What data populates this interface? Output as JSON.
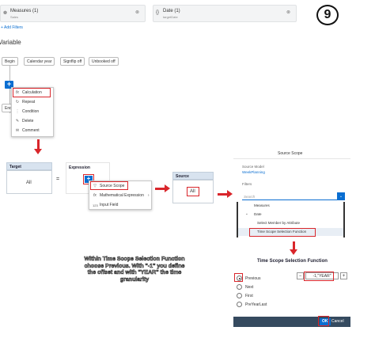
{
  "filters": {
    "measures_title": "Measures (1)",
    "measures_sub": "Sales",
    "date_title": "Date (1)",
    "date_sub": "targetDate",
    "add_filters": "+ Add Filters"
  },
  "step_badge": "9",
  "variable_label": "Variable",
  "timeline": {
    "begin": "Begin",
    "end": "End",
    "chips": [
      "Calendar year",
      "Signflip off",
      "Unbooked off"
    ]
  },
  "add_menu": {
    "items": [
      {
        "icon": "fx",
        "label": "Calculation"
      },
      {
        "icon": "↻",
        "label": "Repeat"
      },
      {
        "icon": "⋮",
        "label": "Condition"
      },
      {
        "icon": "✎",
        "label": "Delete"
      },
      {
        "icon": "✉",
        "label": "Comment"
      }
    ]
  },
  "formula": {
    "target_header": "Target",
    "target_value": "All",
    "equals": "=",
    "expression_header": "Expression",
    "source_header": "Source",
    "source_value": "All"
  },
  "expr_menu": {
    "items": [
      {
        "icon": "▽",
        "label": "Source Scope",
        "arrow": ""
      },
      {
        "icon": "fx",
        "label": "Mathematical Expression",
        "arrow": "›"
      },
      {
        "icon": "123",
        "label": "Input Field",
        "arrow": ""
      }
    ]
  },
  "source_scope": {
    "title": "Source Scope",
    "model_label": "Source Model",
    "model_value": "WeekPlanning",
    "filters_label": "Filters",
    "search_placeholder": "Search",
    "tree": [
      "Measures",
      "Date",
      "Select Member by Attribute",
      "Time Scope Selection Function"
    ]
  },
  "note_text": "Within Time Scope Selection Function choose Previous. With \"-1\" you define the offset and with \"YEAR\" the time granularity",
  "tssf": {
    "title": "Time Scope Selection Function",
    "options": [
      {
        "label": "Previous",
        "selected": true
      },
      {
        "label": "Next",
        "selected": false
      },
      {
        "label": "First",
        "selected": false
      },
      {
        "label": "PreYearLast",
        "selected": false
      }
    ],
    "stepper_minus": "−",
    "stepper_value": "-1,\"YEAR\"",
    "stepper_plus": "+",
    "ok": "OK",
    "cancel": "Cancel"
  },
  "colors": {
    "highlight": "#d9262b",
    "accent": "#0a6ed1",
    "dark_footer": "#354a5f"
  }
}
